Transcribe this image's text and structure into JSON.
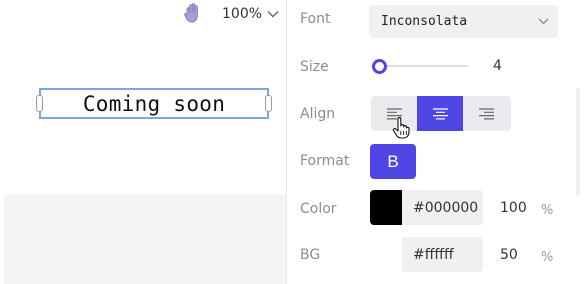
{
  "canvas": {
    "zoom": "100%",
    "text": "Coming soon"
  },
  "panel": {
    "font": {
      "label": "Font",
      "value": "Inconsolata"
    },
    "size": {
      "label": "Size",
      "value": "4",
      "level": 0.0
    },
    "align": {
      "label": "Align",
      "options": [
        "left",
        "center",
        "right"
      ],
      "selected": "center"
    },
    "format": {
      "label": "Format",
      "bold_label": "B"
    },
    "color": {
      "label": "Color",
      "hex": "#000000",
      "opacity": "100",
      "unit": "%"
    },
    "bg": {
      "label": "BG",
      "hex": "#ffffff",
      "opacity": "50",
      "unit": "%"
    }
  },
  "colors": {
    "accent": "#4f46e5",
    "text_color_swatch": "#000000",
    "bg_swatch": "#ffffff",
    "selection_border": "#7aa8dc"
  },
  "icons": [
    "hand-tool-icon",
    "chevron-down-icon",
    "align-left-icon",
    "align-center-icon",
    "align-right-icon",
    "pointer-hand-icon"
  ]
}
